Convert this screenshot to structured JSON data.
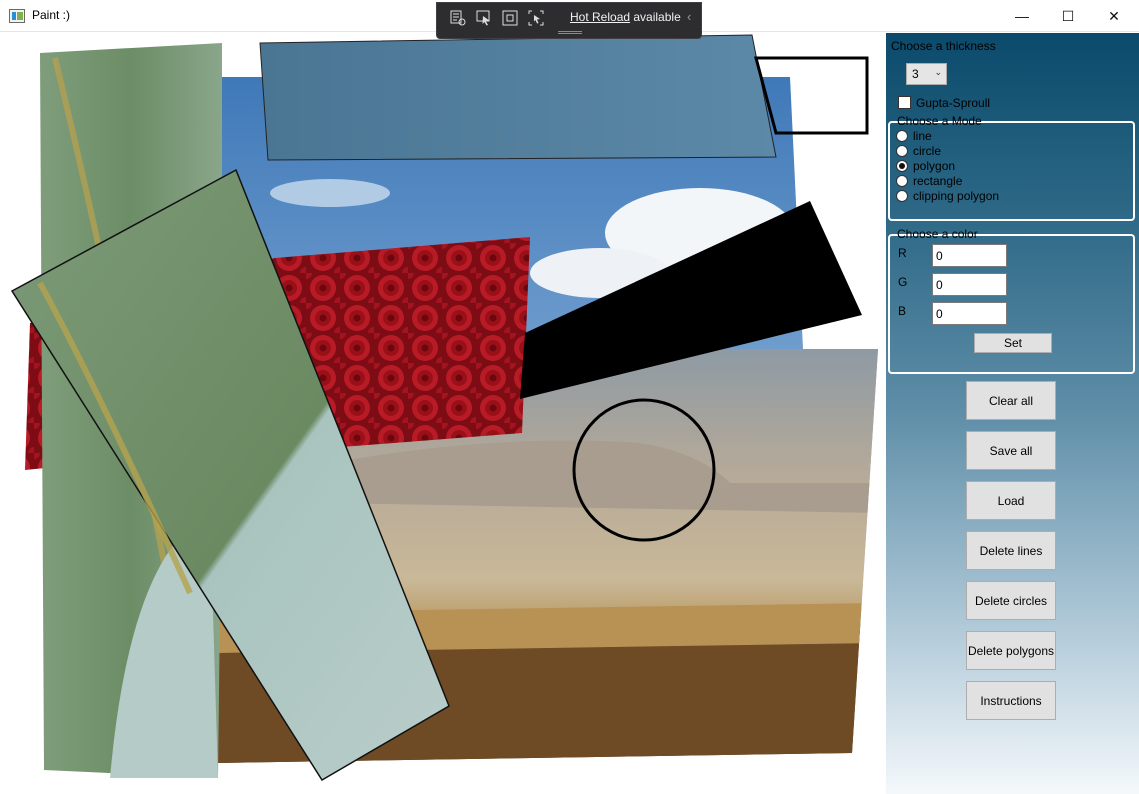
{
  "window": {
    "title": "Paint :)",
    "minimize_glyph": "—",
    "maximize_glyph": "☐",
    "close_glyph": "✕"
  },
  "hot_reload": {
    "link_text": "Hot Reload",
    "suffix_text": " available",
    "tools": [
      "visual-tree-icon",
      "select-element-icon",
      "display-layout-adorners-icon",
      "track-focus-icon"
    ],
    "chevron": "‹"
  },
  "panel": {
    "thickness_label": "Choose a thickness",
    "thickness_value": "3",
    "thickness_arrow": "⌄",
    "gupta_label": "Gupta-Sproull",
    "gupta_checked": false,
    "mode_title": "Choose a Mode",
    "modes": [
      {
        "label": "line",
        "checked": false
      },
      {
        "label": "circle",
        "checked": false
      },
      {
        "label": "polygon",
        "checked": true
      },
      {
        "label": "rectangle",
        "checked": false
      },
      {
        "label": "clipping polygon",
        "checked": false
      }
    ],
    "color_title": "Choose a color",
    "color": {
      "r_label": "R",
      "g_label": "G",
      "b_label": "B",
      "r": "0",
      "g": "0",
      "b": "0"
    },
    "set_label": "Set",
    "buttons": {
      "clear_all": "Clear all",
      "save_all": "Save all",
      "load": "Load",
      "delete_lines": "Delete lines",
      "delete_circles": "Delete circles",
      "delete_polygons": "Delete polygons",
      "instructions": "Instructions"
    }
  },
  "colors": {
    "panel_top": "#0b4a6b",
    "panel_bottom": "#f4f8fb",
    "rose_red": "#b01622",
    "leaf_green": "#6f8f6a",
    "sky_blue": "#5a8fc4",
    "stroke": "#000000"
  }
}
